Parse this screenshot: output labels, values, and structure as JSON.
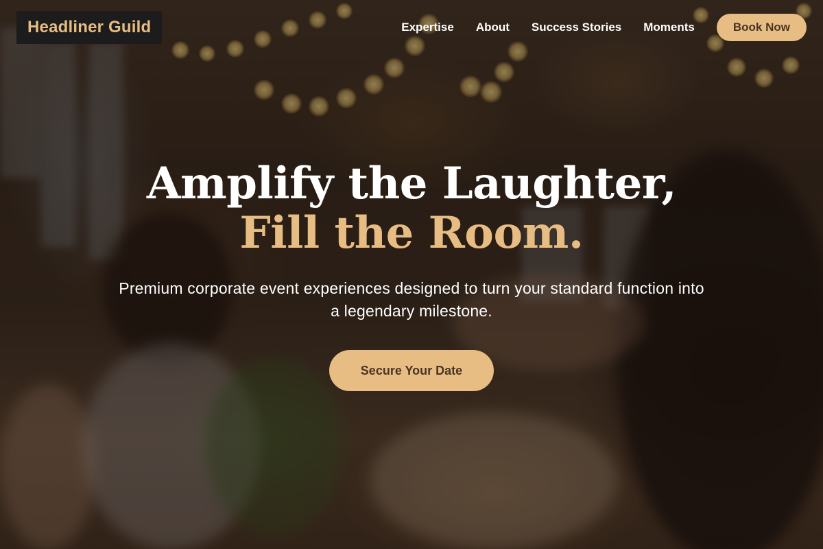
{
  "brand": {
    "name": "Headliner Guild"
  },
  "nav": {
    "links": [
      "Expertise",
      "About",
      "Success Stories",
      "Moments"
    ],
    "cta_label": "Book Now"
  },
  "hero": {
    "headline_white": "Amplify the Laughter, ",
    "headline_accent": "Fill the Room.",
    "subtitle": "Premium corporate event experiences designed to turn your standard function into a legendary milestone.",
    "cta_label": "Secure Your Date",
    "background_description": "blurred banquet hall with string lights and guests raising champagne glasses"
  },
  "colors": {
    "accent": "#e8bd84",
    "brand_background": "#1c1c1c",
    "button_text": "#4a3424",
    "nav_text": "#ffffff"
  }
}
